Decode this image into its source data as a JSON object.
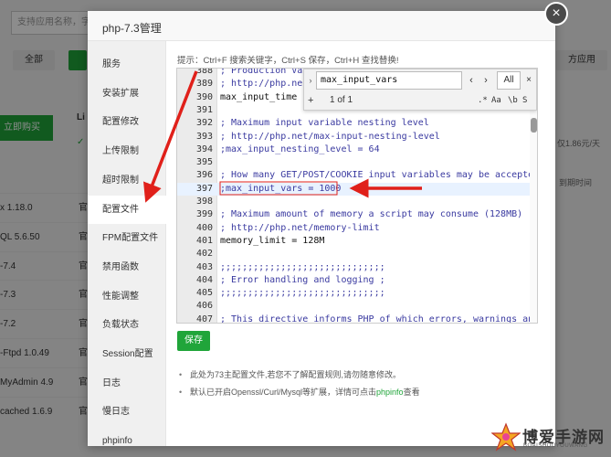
{
  "background": {
    "search_placeholder": "支持应用名称，字",
    "all_button": "全部",
    "right_button": "方应用",
    "buy_button": "立即购买",
    "l_label": "Li",
    "check_mark": "✓",
    "price": "仅1.86元/天",
    "expiry_label": "到期时间",
    "rows": [
      {
        "name": "x 1.18.0",
        "source": "官"
      },
      {
        "name": "QL 5.6.50",
        "source": "官"
      },
      {
        "name": "-7.4",
        "source": "官"
      },
      {
        "name": "-7.3",
        "source": "官"
      },
      {
        "name": "-7.2",
        "source": "官"
      },
      {
        "name": "-Ftpd 1.0.49",
        "source": "官"
      },
      {
        "name": "MyAdmin 4.9",
        "source": "官"
      },
      {
        "name": "cached 1.6.9",
        "source": "官"
      }
    ]
  },
  "modal": {
    "title": "php-7.3管理",
    "close_symbol": "×",
    "menu": [
      {
        "label": "服务",
        "active": false
      },
      {
        "label": "安装扩展",
        "active": false
      },
      {
        "label": "配置修改",
        "active": false
      },
      {
        "label": "上传限制",
        "active": false
      },
      {
        "label": "超时限制",
        "active": false
      },
      {
        "label": "配置文件",
        "active": true
      },
      {
        "label": "FPM配置文件",
        "active": false
      },
      {
        "label": "禁用函数",
        "active": false
      },
      {
        "label": "性能调整",
        "active": false
      },
      {
        "label": "负载状态",
        "active": false
      },
      {
        "label": "Session配置",
        "active": false
      },
      {
        "label": "日志",
        "active": false
      },
      {
        "label": "慢日志",
        "active": false
      },
      {
        "label": "phpinfo",
        "active": false
      }
    ],
    "hint": "提示：Ctrl+F 搜索关键字，Ctrl+S 保存，Ctrl+H 查找替换!",
    "editor_lines": [
      {
        "num": "388",
        "text": "; Production Va",
        "kind": "comment",
        "active": false
      },
      {
        "num": "389",
        "text": "; http://php.ne",
        "kind": "comment",
        "active": false
      },
      {
        "num": "390",
        "text": "max_input_time",
        "kind": "setting",
        "active": false
      },
      {
        "num": "391",
        "text": "",
        "kind": "comment",
        "active": false
      },
      {
        "num": "392",
        "text": "; Maximum input variable nesting level",
        "kind": "comment",
        "active": false
      },
      {
        "num": "393",
        "text": "; http://php.net/max-input-nesting-level",
        "kind": "comment",
        "active": false
      },
      {
        "num": "394",
        "text": ";max_input_nesting_level = 64",
        "kind": "comment",
        "active": false
      },
      {
        "num": "395",
        "text": "",
        "kind": "comment",
        "active": false
      },
      {
        "num": "396",
        "text": "; How many GET/POST/COOKIE input variables may be accepted",
        "kind": "comment",
        "active": false
      },
      {
        "num": "397",
        "text": ";max_input_vars = 1000",
        "kind": "comment",
        "active": true
      },
      {
        "num": "398",
        "text": "",
        "kind": "comment",
        "active": false
      },
      {
        "num": "399",
        "text": "; Maximum amount of memory a script may consume (128MB)",
        "kind": "comment",
        "active": false
      },
      {
        "num": "400",
        "text": "; http://php.net/memory-limit",
        "kind": "comment",
        "active": false
      },
      {
        "num": "401",
        "text": "memory_limit = 128M",
        "kind": "setting",
        "active": false
      },
      {
        "num": "402",
        "text": "",
        "kind": "comment",
        "active": false
      },
      {
        "num": "403",
        "text": ";;;;;;;;;;;;;;;;;;;;;;;;;;;;;;",
        "kind": "comment",
        "active": false
      },
      {
        "num": "404",
        "text": "; Error handling and logging ;",
        "kind": "comment",
        "active": false
      },
      {
        "num": "405",
        "text": ";;;;;;;;;;;;;;;;;;;;;;;;;;;;;;",
        "kind": "comment",
        "active": false
      },
      {
        "num": "406",
        "text": "",
        "kind": "comment",
        "active": false
      },
      {
        "num": "407",
        "text": "; This directive informs PHP of which errors, warnings and",
        "kind": "comment",
        "active": false
      }
    ],
    "search": {
      "query": "max_input_vars",
      "toggle": "›",
      "prev": "‹",
      "next": "›",
      "all": "All",
      "close": "×",
      "plus": "+",
      "count": "1 of 1",
      "regex": ".*",
      "case": "Aa",
      "word": "\\b",
      "selection": "S"
    },
    "save_label": "保存",
    "notes": [
      {
        "text": "此处为73主配置文件,若您不了解配置规则,请勿随意修改。",
        "link": "",
        "after": ""
      },
      {
        "text": "默认已开启Openssl/Curl/Mysql等扩展，详情可点击",
        "link": "phpinfo",
        "after": "查看"
      }
    ]
  },
  "watermark": {
    "title": "博爱手游网",
    "subtitle": "BOAISHOUYOUWANG"
  },
  "colors": {
    "accent_green": "#20a53a",
    "arrow_red": "#e0201a",
    "comment_blue": "#3a3aa0"
  }
}
